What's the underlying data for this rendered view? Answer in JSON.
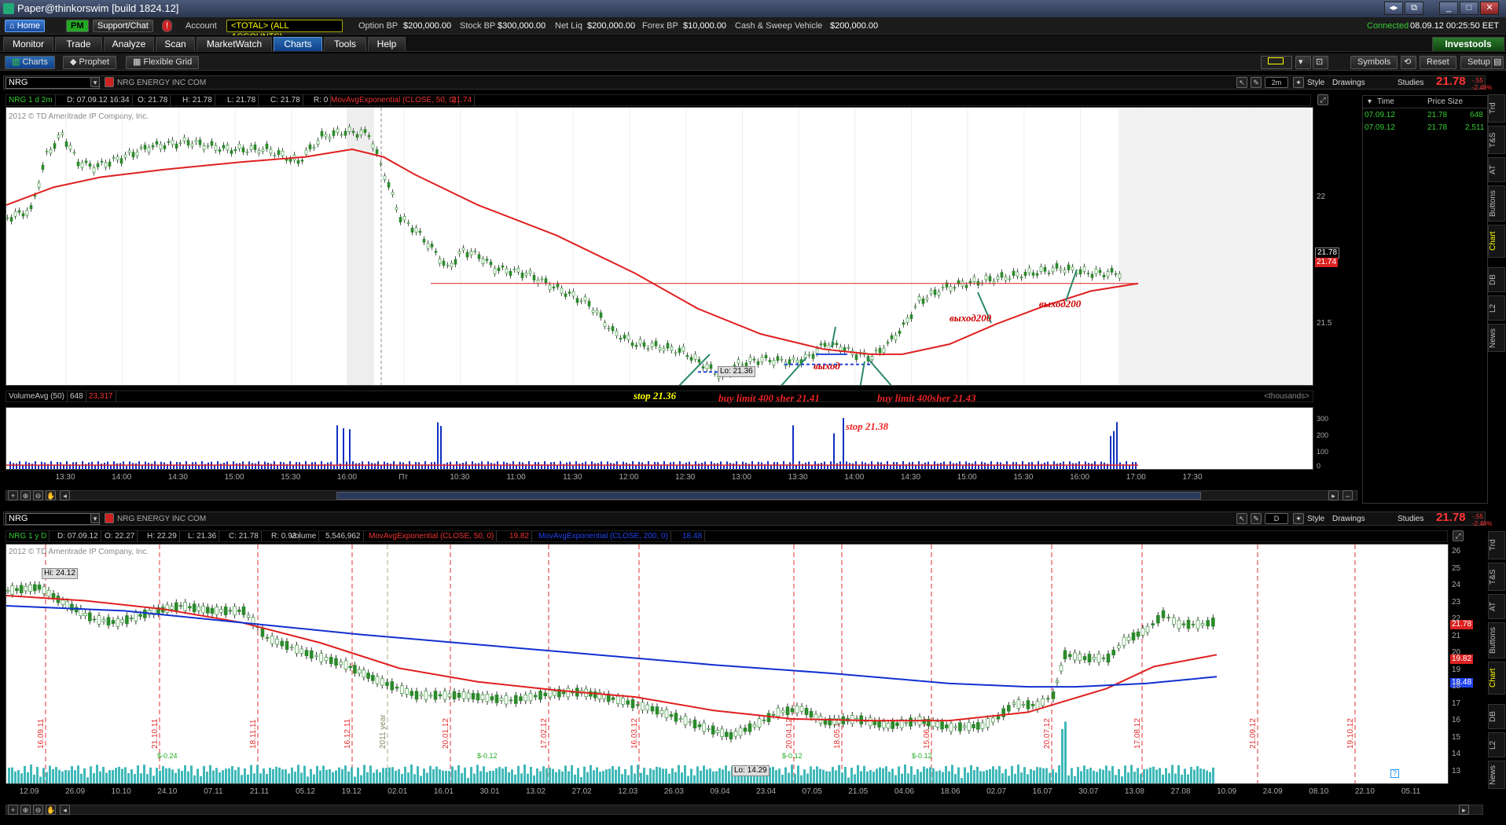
{
  "window": {
    "title": "Paper@thinkorswim [build 1824.12]"
  },
  "accountbar": {
    "home": "Home",
    "pm": "PM",
    "support": "Support/Chat",
    "alert": "!",
    "account_label": "Account",
    "account_value": "<TOTAL> (ALL ACCOUNTS)",
    "option_bp_label": "Option BP",
    "option_bp": "$200,000.00",
    "stock_bp_label": "Stock BP",
    "stock_bp": "$300,000.00",
    "net_liq_label": "Net Liq",
    "net_liq": "$200,000.00",
    "forex_bp_label": "Forex BP",
    "forex_bp": "$10,000.00",
    "cash_label": "Cash & Sweep Vehicle",
    "cash": "$200,000.00",
    "connected": "Connected",
    "datetime": "08.09.12 00:25:50 EET"
  },
  "menu": {
    "tabs": [
      "Monitor",
      "Trade",
      "Analyze",
      "Scan",
      "MarketWatch",
      "Charts",
      "Tools",
      "Help"
    ],
    "active": "Charts",
    "brand": "Investools"
  },
  "subbar": {
    "charts": "Charts",
    "prophet": "Prophet",
    "grid": "Flexible Grid",
    "symbols": "Symbols",
    "reset": "Reset",
    "setup": "Setup"
  },
  "top_chart": {
    "symbol": "NRG",
    "title": "NRG ENERGY INC COM",
    "agg": "2m",
    "style": "Style",
    "drawings": "Drawings",
    "studies": "Studies",
    "last": "21.78",
    "change": "-.55",
    "change_pct": "-2.46%",
    "header": {
      "period": "NRG 1 d 2m",
      "d": "D: 07.09.12 16:34",
      "o": "O: 21.78",
      "h": "H: 21.78",
      "l": "L: 21.78",
      "c": "C: 21.78",
      "r": "R: 0",
      "ma": "MovAvgExponential (CLOSE, 50, 0)",
      "ma_val": "21.74"
    },
    "copyright": "2012 © TD Ameritrade IP Company, Inc.",
    "yticks": [
      {
        "v": 22,
        "t": "22"
      },
      {
        "v": 21.5,
        "t": "21.5"
      }
    ],
    "last_tag": "21.78",
    "ma_tag": "21.74",
    "lo_label": "Lo: 21.36",
    "volume": {
      "label": "VolumeAvg (50)",
      "v1": "648",
      "v2": "23,317",
      "units": "<thousands>",
      "ticks": [
        "300",
        "200",
        "100",
        "0"
      ]
    },
    "xticks": [
      "13:30",
      "14:00",
      "14:30",
      "15:00",
      "15:30",
      "16:00",
      "Пт",
      "10:30",
      "11:00",
      "11:30",
      "12:00",
      "12:30",
      "13:00",
      "13:30",
      "14:00",
      "14:30",
      "15:00",
      "15:30",
      "16:00",
      "17:00",
      "17:30"
    ],
    "annotations": {
      "stop1": "stop 21.36",
      "buy1": "buy limit 400 sher 21.41",
      "exit1": "выход",
      "stop2": "stop 21.38",
      "buy2": "buy limit 400sher 21.43",
      "exit2": "выход200",
      "exit3": "выход200"
    }
  },
  "bottom_chart": {
    "symbol": "NRG",
    "title": "NRG ENERGY INC COM",
    "agg": "D",
    "style": "Style",
    "drawings": "Drawings",
    "studies": "Studies",
    "last": "21.78",
    "change": "-.55",
    "change_pct": "-2.46%",
    "header": {
      "period": "NRG 1 y D",
      "d": "D: 07.09.12",
      "o": "O: 22.27",
      "h": "H: 22.29",
      "l": "L: 21.36",
      "c": "C: 21.78",
      "r": "R: 0.93",
      "vol_label": "Volume",
      "vol": "5,546,962",
      "ma50": "MovAvgExponential (CLOSE, 50, 0)",
      "ma50_val": "19.82",
      "ma200": "MovAvgExponential (CLOSE, 200, 0)",
      "ma200_val": "18.48"
    },
    "copyright": "2012 © TD Ameritrade IP Company, Inc.",
    "hi_label": "Hi: 24.12",
    "lo_label": "Lo: 14.29",
    "yticks": [
      "26",
      "25",
      "24",
      "23",
      "22",
      "21",
      "20",
      "19",
      "18",
      "17",
      "16",
      "15",
      "14",
      "13"
    ],
    "last_tag": "21.78",
    "ma50_tag": "19.82",
    "ma200_tag": "18.48",
    "xticks": [
      "12.09",
      "26.09",
      "10.10",
      "24.10",
      "07.11",
      "21.11",
      "05.12",
      "19.12",
      "02.01",
      "16.01",
      "30.01",
      "13.02",
      "27.02",
      "12.03",
      "26.03",
      "09.04",
      "23.04",
      "07.05",
      "21.05",
      "04.06",
      "18.06",
      "02.07",
      "16.07",
      "30.07",
      "13.08",
      "27.08",
      "10.09",
      "24.09",
      "08.10",
      "22.10",
      "05.11"
    ],
    "dates_vertical": [
      "16.09.11",
      "21.10.11",
      "18.11.11",
      "16.12.11",
      "2011 year",
      "20.01.12",
      "17.02.12",
      "16.03.12",
      "20.04.12",
      "18.05.12",
      "15.06.12",
      "20.07.12",
      "17.08.12",
      "21.09.12",
      "19.10.12"
    ],
    "divs": [
      "$-0.24",
      "$-0.12",
      "$-0.12",
      "$-0.12"
    ]
  },
  "timesales": {
    "col_time": "Time",
    "col_price": "Price Size",
    "rows": [
      {
        "time": "07.09.12",
        "price": "21.78",
        "size": "648"
      },
      {
        "time": "07.09.12",
        "price": "21.78",
        "size": "2,511"
      }
    ]
  },
  "sidetabs": [
    "Trd",
    "T&S",
    "AT",
    "Buttons",
    "Chart",
    "DB",
    "L2",
    "News"
  ],
  "colors": {
    "ma50": "#e02020",
    "ma200": "#1030d0",
    "candle": "#2a8a2a",
    "volume": "#40b8b8",
    "accent": "#2a6bb0"
  }
}
